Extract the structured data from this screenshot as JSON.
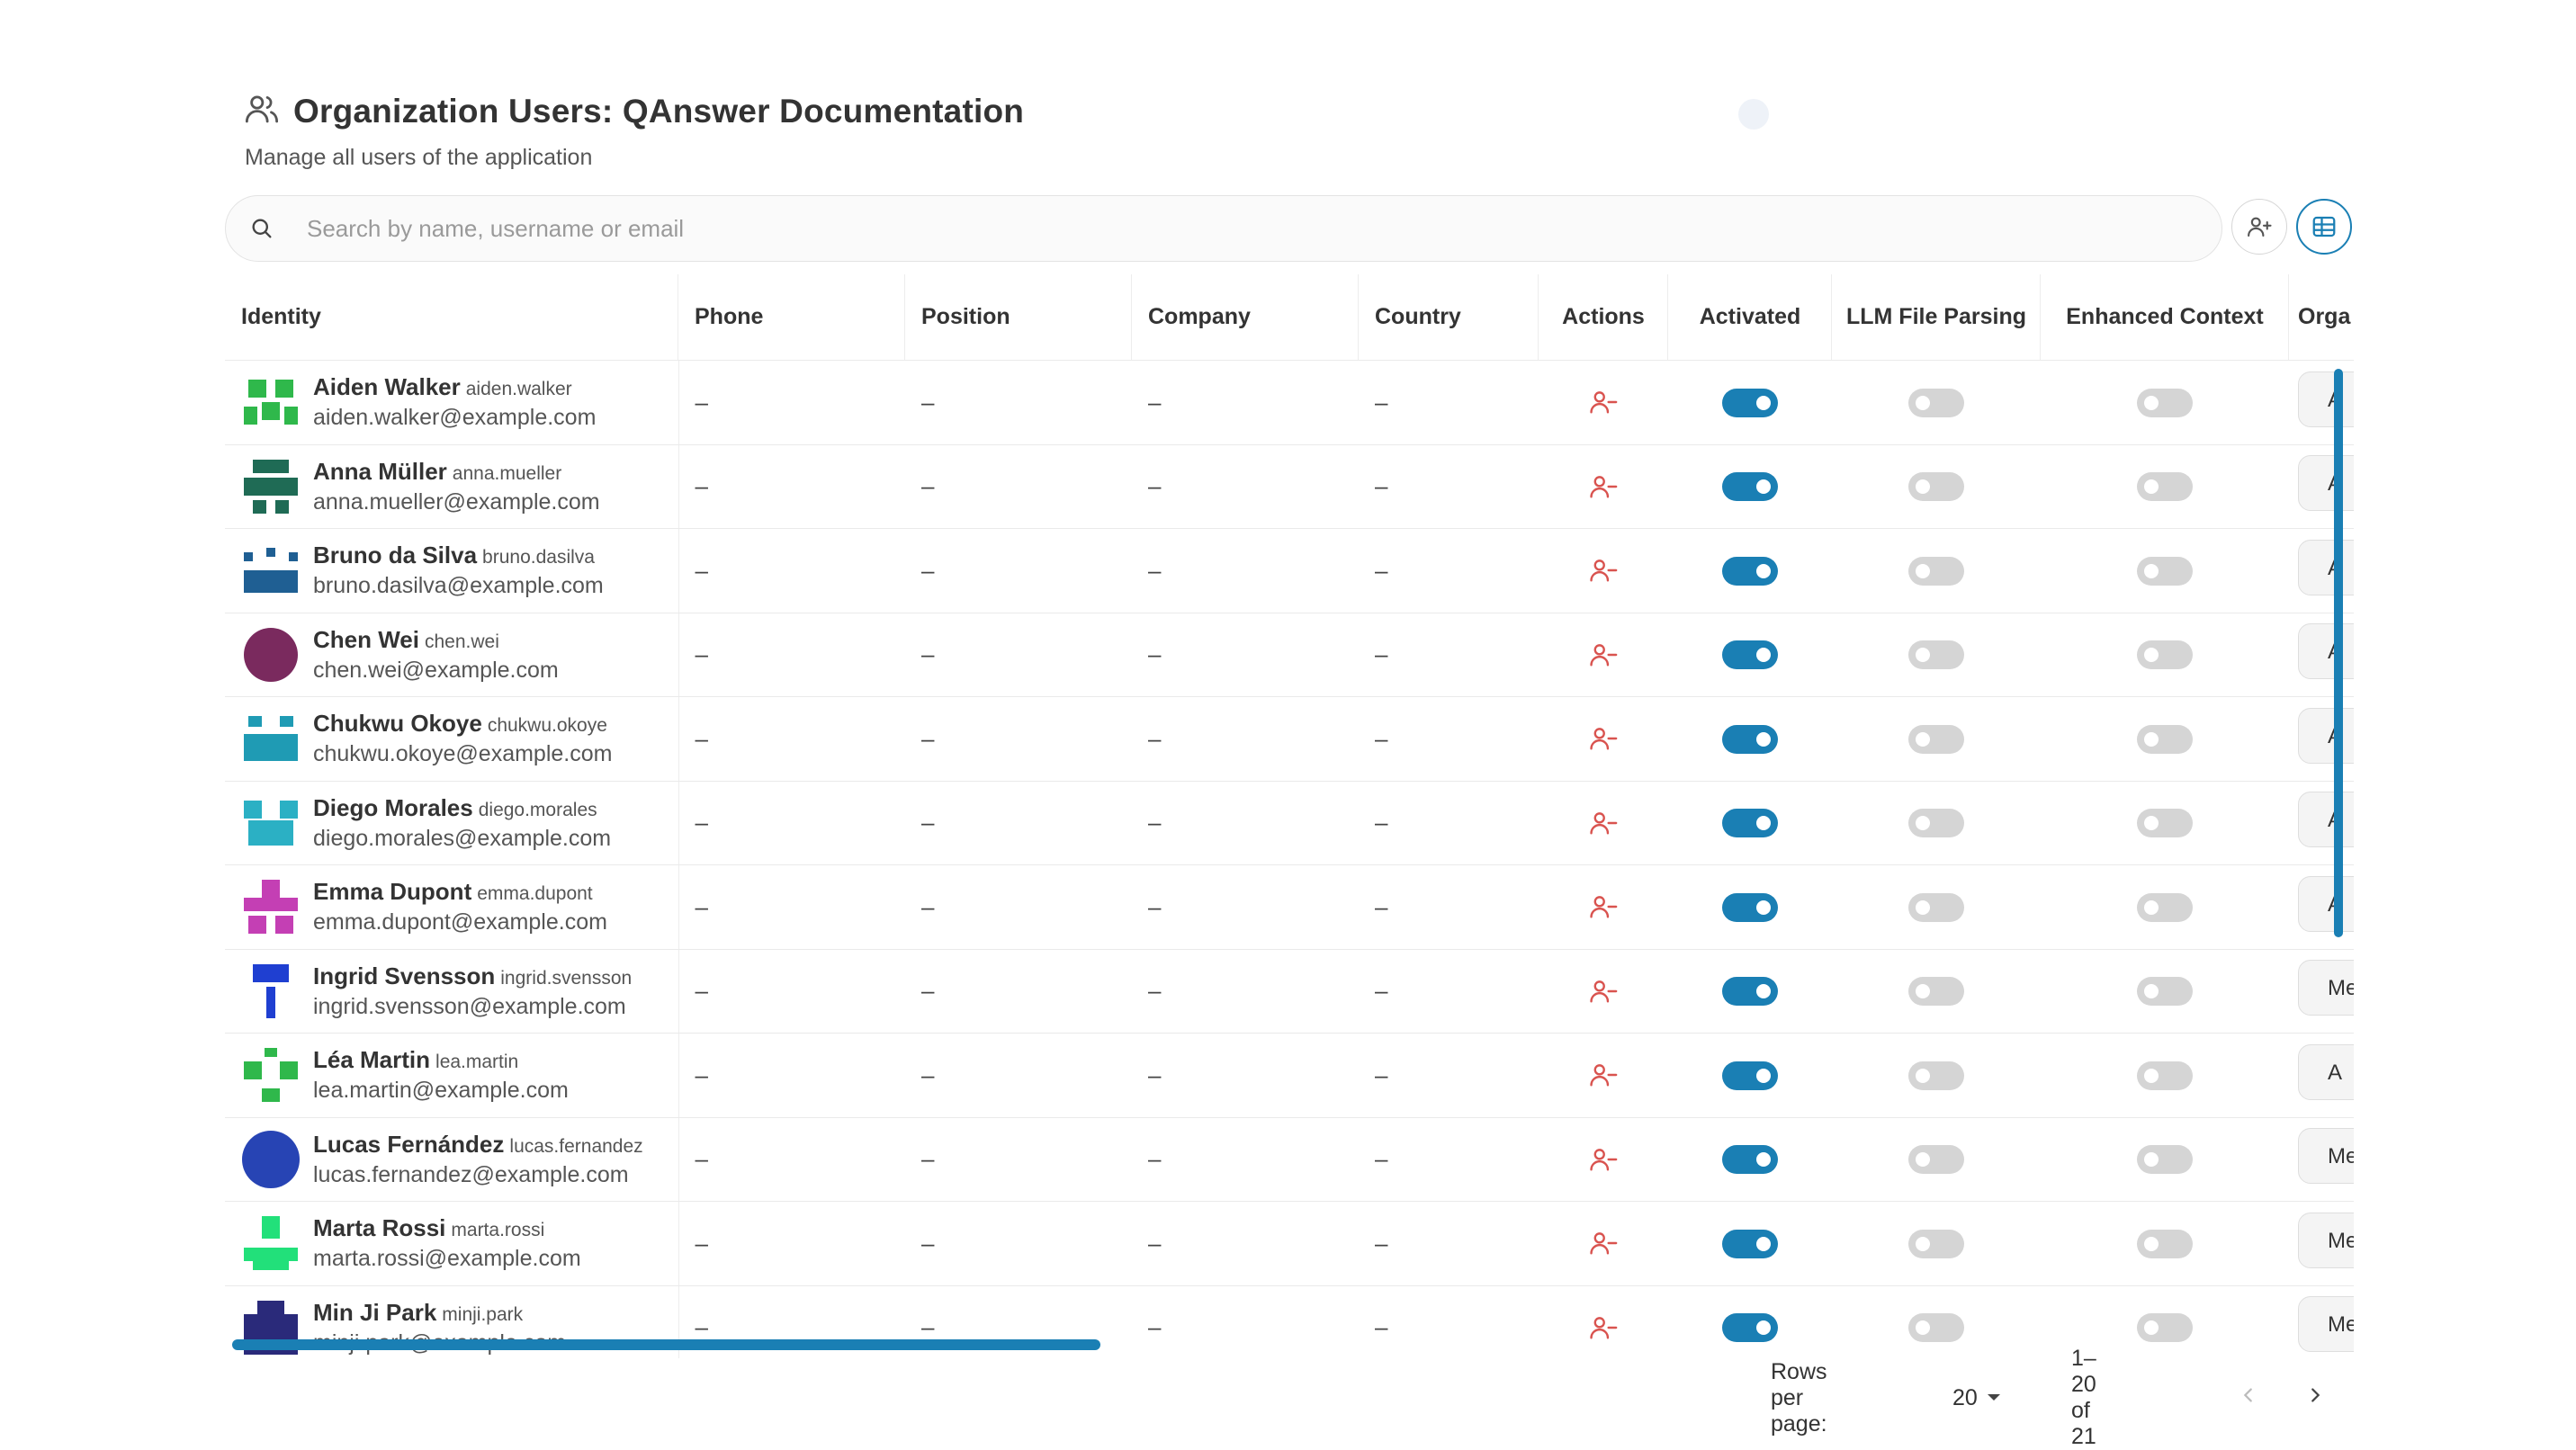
{
  "header": {
    "title": "Organization Users: QAnswer Documentation",
    "subtitle": "Manage all users of the application",
    "icon": "users-icon"
  },
  "search": {
    "placeholder": "Search by name, username or email",
    "value": ""
  },
  "toolbar": {
    "add_user_icon": "user-plus-icon",
    "table_view_icon": "table-icon"
  },
  "columns": {
    "identity": "Identity",
    "phone": "Phone",
    "position": "Position",
    "company": "Company",
    "country": "Country",
    "actions": "Actions",
    "activated": "Activated",
    "llm_parsing": "LLM File Parsing",
    "enhanced_context": "Enhanced Context",
    "organization": "Orga"
  },
  "colors": {
    "accent": "#1a7fb4",
    "danger_icon": "#d9534f"
  },
  "rows": [
    {
      "name": "Aiden Walker",
      "username": "aiden.walker",
      "email": "aiden.walker@example.com",
      "phone": "–",
      "position": "–",
      "company": "–",
      "country": "–",
      "activated": true,
      "llm": false,
      "enhanced": false,
      "org": "A",
      "avatar_color": "#2fb84b"
    },
    {
      "name": "Anna Müller",
      "username": "anna.mueller",
      "email": "anna.mueller@example.com",
      "phone": "–",
      "position": "–",
      "company": "–",
      "country": "–",
      "activated": true,
      "llm": false,
      "enhanced": false,
      "org": "A",
      "avatar_color": "#1f6b55"
    },
    {
      "name": "Bruno da Silva",
      "username": "bruno.dasilva",
      "email": "bruno.dasilva@example.com",
      "phone": "–",
      "position": "–",
      "company": "–",
      "country": "–",
      "activated": true,
      "llm": false,
      "enhanced": false,
      "org": "A",
      "avatar_color": "#1f5f93"
    },
    {
      "name": "Chen Wei",
      "username": "chen.wei",
      "email": "chen.wei@example.com",
      "phone": "–",
      "position": "–",
      "company": "–",
      "country": "–",
      "activated": true,
      "llm": false,
      "enhanced": false,
      "org": "A",
      "avatar_color": "#7a2a5e"
    },
    {
      "name": "Chukwu Okoye",
      "username": "chukwu.okoye",
      "email": "chukwu.okoye@example.com",
      "phone": "–",
      "position": "–",
      "company": "–",
      "country": "–",
      "activated": true,
      "llm": false,
      "enhanced": false,
      "org": "A",
      "avatar_color": "#1f9bb4"
    },
    {
      "name": "Diego Morales",
      "username": "diego.morales",
      "email": "diego.morales@example.com",
      "phone": "–",
      "position": "–",
      "company": "–",
      "country": "–",
      "activated": true,
      "llm": false,
      "enhanced": false,
      "org": "A",
      "avatar_color": "#2bb0c4"
    },
    {
      "name": "Emma Dupont",
      "username": "emma.dupont",
      "email": "emma.dupont@example.com",
      "phone": "–",
      "position": "–",
      "company": "–",
      "country": "–",
      "activated": true,
      "llm": false,
      "enhanced": false,
      "org": "A",
      "avatar_color": "#c43fb4"
    },
    {
      "name": "Ingrid Svensson",
      "username": "ingrid.svensson",
      "email": "ingrid.svensson@example.com",
      "phone": "–",
      "position": "–",
      "company": "–",
      "country": "–",
      "activated": true,
      "llm": false,
      "enhanced": false,
      "org": "Me",
      "avatar_color": "#1f3fd1"
    },
    {
      "name": "Léa Martin",
      "username": "lea.martin",
      "email": "lea.martin@example.com",
      "phone": "–",
      "position": "–",
      "company": "–",
      "country": "–",
      "activated": true,
      "llm": false,
      "enhanced": false,
      "org": "A",
      "avatar_color": "#2fb84b"
    },
    {
      "name": "Lucas Fernández",
      "username": "lucas.fernandez",
      "email": "lucas.fernandez@example.com",
      "phone": "–",
      "position": "–",
      "company": "–",
      "country": "–",
      "activated": true,
      "llm": false,
      "enhanced": false,
      "org": "Me",
      "avatar_color": "#2744b4"
    },
    {
      "name": "Marta Rossi",
      "username": "marta.rossi",
      "email": "marta.rossi@example.com",
      "phone": "–",
      "position": "–",
      "company": "–",
      "country": "–",
      "activated": true,
      "llm": false,
      "enhanced": false,
      "org": "Me",
      "avatar_color": "#22e07a"
    },
    {
      "name": "Min Ji Park",
      "username": "minji.park",
      "email": "minji.park@example.com",
      "phone": "–",
      "position": "–",
      "company": "–",
      "country": "–",
      "activated": true,
      "llm": false,
      "enhanced": false,
      "org": "Me",
      "avatar_color": "#2a2a7a"
    }
  ],
  "pagination": {
    "rows_per_page_label": "Rows per page:",
    "rows_per_page": "20",
    "range": "1–20 of 21"
  }
}
